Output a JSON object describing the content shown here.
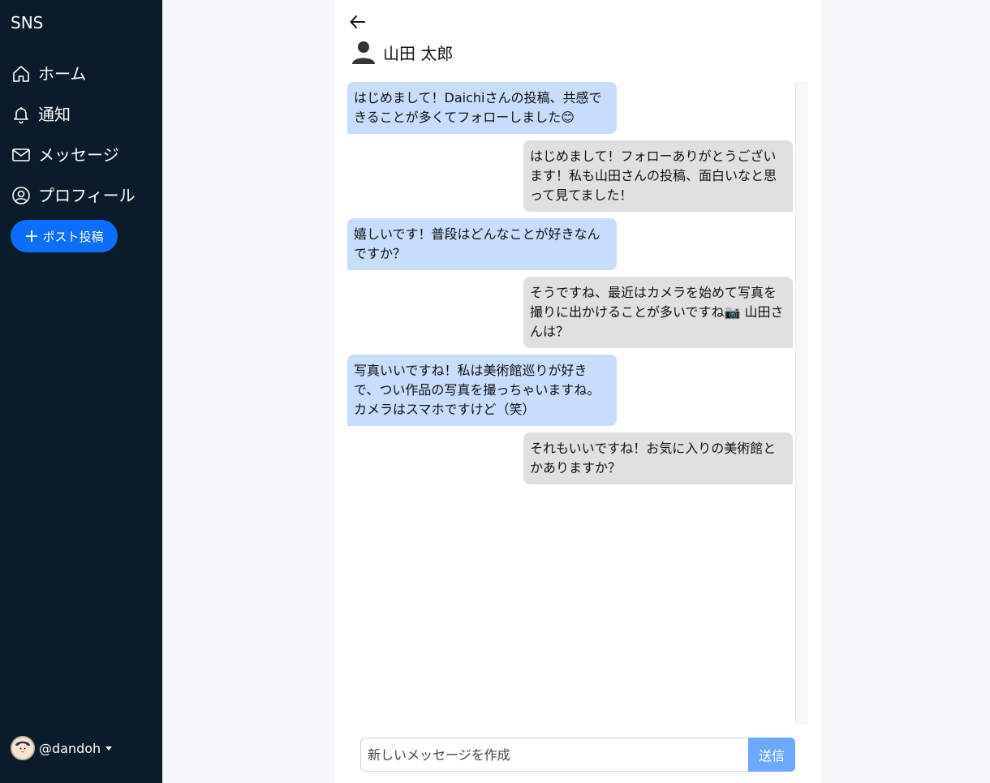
{
  "app": {
    "brand": "SNS"
  },
  "sidebar": {
    "items": [
      {
        "label": "ホーム",
        "icon": "home-icon"
      },
      {
        "label": "通知",
        "icon": "bell-icon"
      },
      {
        "label": "メッセージ",
        "icon": "envelope-icon"
      },
      {
        "label": "プロフィール",
        "icon": "person-circle-icon"
      }
    ],
    "post_button_label": "ポスト投稿",
    "account_handle": "@dandoh"
  },
  "chat": {
    "partner_name": "山田 太郎",
    "messages": [
      {
        "side": "received",
        "text": "はじめまして！Daichiさんの投稿、共感できることが多くてフォローしました😊"
      },
      {
        "side": "sent",
        "text": "はじめまして！フォローありがとうございます！私も山田さんの投稿、面白いなと思って見てました！"
      },
      {
        "side": "received",
        "text": "嬉しいです！普段はどんなことが好きなんですか？"
      },
      {
        "side": "sent",
        "text": "そうですね、最近はカメラを始めて写真を撮りに出かけることが多いですね📷 山田さんは？"
      },
      {
        "side": "received",
        "text": "写真いいですね！私は美術館巡りが好きで、つい作品の写真を撮っちゃいますね。カメラはスマホですけど（笑）"
      },
      {
        "side": "sent",
        "text": "それもいいですね！お気に入りの美術館とかありますか？"
      }
    ],
    "composer": {
      "placeholder": "新しいメッセージを作成",
      "value": "",
      "send_label": "送信"
    }
  },
  "colors": {
    "sidebar_bg": "#0b1b2a",
    "accent": "#0d6efd",
    "received_bubble": "#c7ddfb",
    "sent_bubble": "#e0e0e0",
    "send_button": "#6ea8fe"
  }
}
